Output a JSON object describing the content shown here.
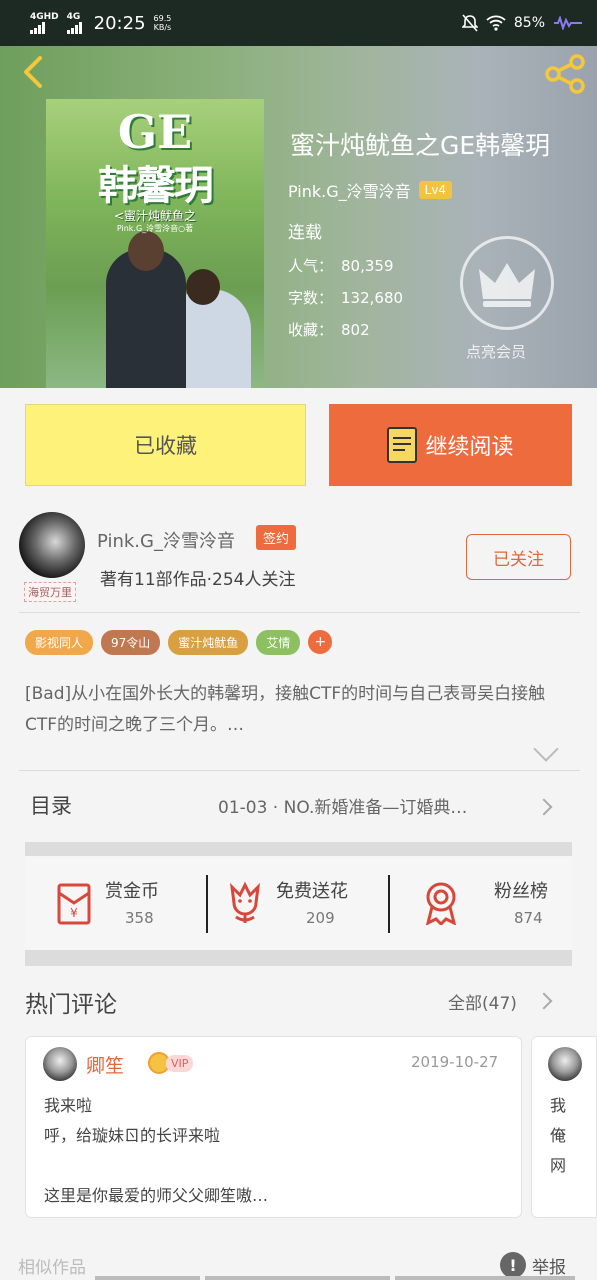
{
  "status_bar": {
    "net1": "4GHD",
    "net2": "4G",
    "time": "20:25",
    "speed_value": "69.5",
    "speed_unit": "KB/s",
    "battery": "85%"
  },
  "book": {
    "title": "蜜汁炖鱿鱼之GE韩馨玥",
    "author": "Pink.G_泠雪泠音",
    "author_level": "Lv4",
    "status": "连载",
    "popularity_label": "人气：",
    "popularity": "80,359",
    "words_label": "字数：",
    "words": "132,680",
    "collect_label": "收藏：",
    "collect": "802",
    "vip_cta": "点亮会员",
    "cover": {
      "ge": "GE",
      "title": "韩馨玥",
      "subtitle": "<蜜汁炖鱿鱼之",
      "author": "Pink.G_泠雪泠音○著"
    }
  },
  "actions": {
    "collected_label": "已收藏",
    "continue_label": "继续阅读"
  },
  "author_card": {
    "name": "Pink.G_泠雪泠音",
    "badge": "海贸万里",
    "signed": "签约",
    "meta": "著有11部作品·254人关注",
    "follow_label": "已关注"
  },
  "tags": [
    {
      "label": "影视同人",
      "color": "#f0a84a"
    },
    {
      "label": "97令山",
      "color": "#c07850"
    },
    {
      "label": "蜜汁炖鱿鱼",
      "color": "#d8a040"
    },
    {
      "label": "艾情",
      "color": "#8cc060"
    }
  ],
  "tag_plus": "+",
  "summary": "[Bad]从小在国外长大的韩馨玥，接触CTF的时间与自己表哥吴白接触CTF的时间之晚了三个月。…",
  "toc": {
    "label": "目录",
    "latest": "01-03 · NO.新婚准备—订婚典…"
  },
  "rewards": [
    {
      "label": "赏金币",
      "count": "358",
      "icon": "red-envelope-icon"
    },
    {
      "label": "免费送花",
      "count": "209",
      "icon": "flower-icon"
    },
    {
      "label": "粉丝榜",
      "count": "874",
      "icon": "medal-icon"
    }
  ],
  "comments_section": {
    "title": "热门评论",
    "all_label": "全部(47)"
  },
  "comment": {
    "name": "卿笙",
    "vip": "VIP",
    "date": "2019-10-27",
    "text": "我来啦\n呼，给璇妹ㄖ的长评来啦\n\n这里是你最爱的师父父卿笙嗷…"
  },
  "comment2": {
    "text": "我\n俺\n网"
  },
  "footer": {
    "similar": "相似作品",
    "report": "举报",
    "report_icon": "!"
  },
  "colors": {
    "accent": "#ee6b3d",
    "collected_bg": "#fff27b",
    "level_badge": "#f2c240"
  }
}
